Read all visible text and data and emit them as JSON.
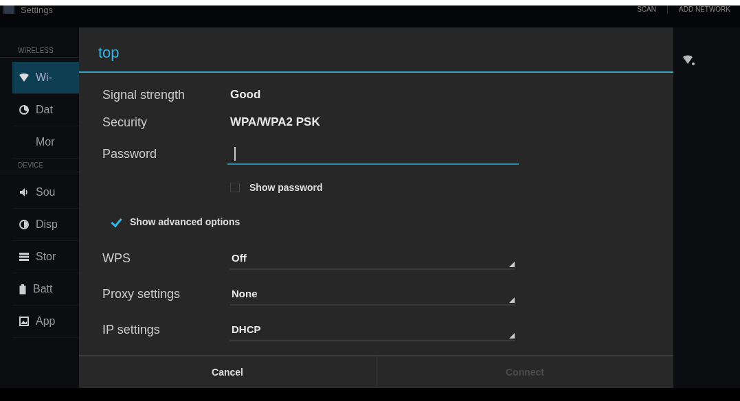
{
  "action_bar": {
    "title": "Settings",
    "actions": [
      "SCAN",
      "ADD NETWORK"
    ]
  },
  "sidebar": {
    "sections": [
      {
        "header": "WIRELESS",
        "items": [
          {
            "label": "Wi-",
            "selected": true
          },
          {
            "label": "Dat",
            "selected": false
          },
          {
            "label": "Mor",
            "selected": false
          }
        ]
      },
      {
        "header": "DEVICE",
        "items": [
          {
            "label": "Sou",
            "selected": false
          },
          {
            "label": "Disp",
            "selected": false
          },
          {
            "label": "Stor",
            "selected": false
          },
          {
            "label": "Batt",
            "selected": false
          },
          {
            "label": "App",
            "selected": false
          }
        ]
      }
    ]
  },
  "dialog": {
    "title": "top",
    "info": [
      {
        "label": "Signal strength",
        "value": "Good"
      },
      {
        "label": "Security",
        "value": "WPA/WPA2 PSK"
      }
    ],
    "password": {
      "label": "Password",
      "focused": true
    },
    "show_password": {
      "label": "Show password",
      "checked": false
    },
    "advanced": {
      "label": "Show advanced options",
      "checked": true
    },
    "spinners": [
      {
        "label": "WPS",
        "value": "Off"
      },
      {
        "label": "Proxy settings",
        "value": "None"
      },
      {
        "label": "IP settings",
        "value": "DHCP"
      }
    ],
    "buttons": [
      {
        "label": "Cancel",
        "disabled": false
      },
      {
        "label": "Connect",
        "disabled": true
      }
    ]
  }
}
